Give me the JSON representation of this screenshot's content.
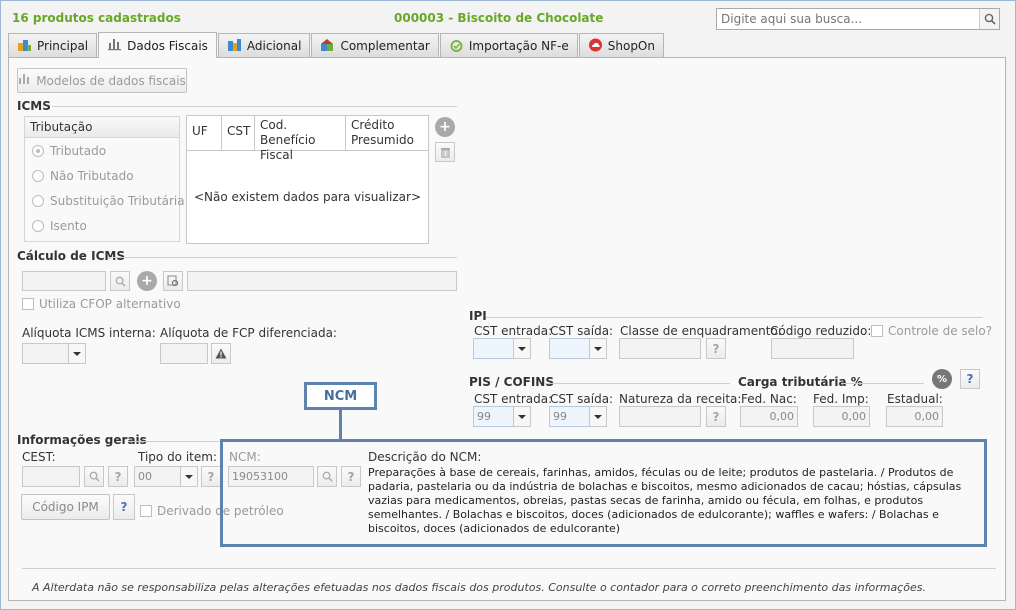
{
  "header": {
    "product_count": "16 produtos cadastrados",
    "product_title": "000003 - Biscoito de Chocolate",
    "search_placeholder": "Digite aqui sua busca..."
  },
  "tabs": [
    {
      "label": "Principal",
      "icon": "principal-icon"
    },
    {
      "label": "Dados Fiscais",
      "icon": "fiscal-chart-icon"
    },
    {
      "label": "Adicional",
      "icon": "adicional-icon"
    },
    {
      "label": "Complementar",
      "icon": "complementar-icon"
    },
    {
      "label": "Importação NF-e",
      "icon": "nfe-icon"
    },
    {
      "label": "ShopOn",
      "icon": "shopon-cloud-icon"
    }
  ],
  "active_tab": "Dados Fiscais",
  "modelos_button": "Modelos de dados fiscais",
  "icms": {
    "title": "ICMS",
    "tributacao_title": "Tributação",
    "options": [
      "Tributado",
      "Não Tributado",
      "Substituição Tributária",
      "Isento"
    ],
    "selected": "Tributado",
    "table_columns": [
      "UF",
      "CST",
      "Cod. Benefício Fiscal",
      "Crédito Presumido"
    ],
    "empty_message": "<Não existem dados para visualizar>"
  },
  "calculo": {
    "title": "Cálculo de ICMS",
    "cfop_label": "Utiliza CFOP alternativo",
    "aliquota_interna_label": "Alíquota ICMS interna:",
    "aliquota_fcp_label": "Alíquota de FCP diferenciada:"
  },
  "ipi": {
    "title": "IPI",
    "cst_entrada_label": "CST entrada:",
    "cst_saida_label": "CST saída:",
    "classe_label": "Classe de enquadramento:",
    "codigo_reduzido_label": "Código reduzido:",
    "controle_selo_label": "Controle de selo?"
  },
  "pis": {
    "title": "PIS / COFINS",
    "cst_entrada_label": "CST entrada:",
    "cst_entrada_value": "99",
    "cst_saida_label": "CST saída:",
    "cst_saida_value": "99",
    "natureza_label": "Natureza da receita:"
  },
  "carga": {
    "title": "Carga tributária %",
    "fed_nac_label": "Fed. Nac:",
    "fed_nac_value": "0,00",
    "fed_imp_label": "Fed. Imp:",
    "fed_imp_value": "0,00",
    "estadual_label": "Estadual:",
    "estadual_value": "0,00"
  },
  "info": {
    "title": "Informações gerais",
    "cest_label": "CEST:",
    "tipo_label": "Tipo do item:",
    "tipo_value": "00",
    "ncm_label": "NCM:",
    "ncm_value": "19053100",
    "codigo_ipm_button": "Código IPM",
    "derivado_label": "Derivado de petróleo",
    "descricao_label": "Descrição do NCM:",
    "descricao_text": "Preparações à base de cereais, farinhas, amidos, féculas ou de leite; produtos de pastelaria. / Produtos de padaria, pastelaria ou da indústria de bolachas e biscoitos, mesmo adicionados de cacau; hóstias, cápsulas vazias para medicamentos, obreias, pastas secas de farinha, amido ou fécula, em folhas, e produtos semelhantes. / Bolachas e biscoitos, doces (adicionados de edulcorante); waffles e wafers: / Bolachas e biscoitos, doces (adicionados de edulcorante)"
  },
  "annotation_label": "NCM",
  "footer_note": "A Alterdata não se responsabiliza pelas alterações efetuadas nos dados fiscais dos produtos. Consulte o contador para o correto preenchimento das informações.",
  "colors": {
    "header_green": "#6aa629",
    "annotation_blue": "#5e83ad"
  }
}
